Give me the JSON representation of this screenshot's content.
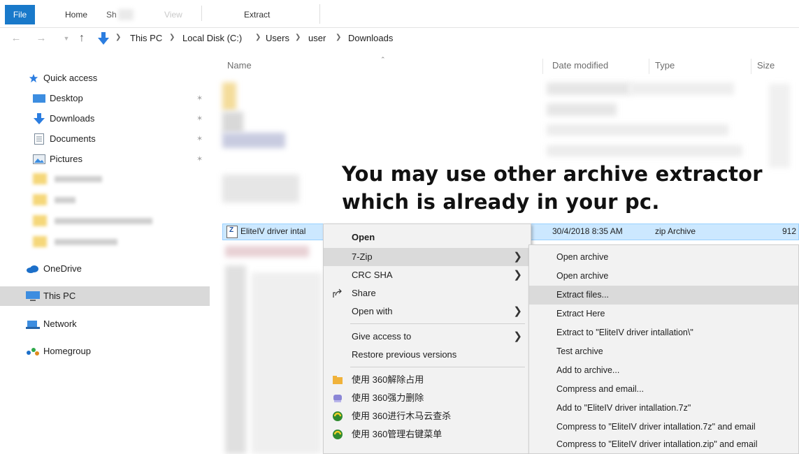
{
  "ribbon": {
    "tabs": [
      {
        "label": "File"
      },
      {
        "label": "Home"
      },
      {
        "label": "Sh"
      },
      {
        "label": "View"
      },
      {
        "label": "Extract"
      }
    ]
  },
  "address": {
    "crumbs": [
      "This PC",
      "Local Disk (C:)",
      "Users",
      "user",
      "Downloads"
    ]
  },
  "nav": {
    "quick_access": "Quick access",
    "pinned": [
      {
        "label": "Desktop",
        "icon": "desktop-icon"
      },
      {
        "label": "Downloads",
        "icon": "download-arrow-icon"
      },
      {
        "label": "Documents",
        "icon": "documents-icon"
      },
      {
        "label": "Pictures",
        "icon": "pictures-icon"
      }
    ],
    "pin_glyph": "✶",
    "onedrive": "OneDrive",
    "this_pc": "This PC",
    "network": "Network",
    "homegroup": "Homegroup"
  },
  "list": {
    "columns": {
      "name": "Name",
      "date": "Date modified",
      "type": "Type",
      "size": "Size"
    },
    "selected": {
      "name": "EliteIV driver intal",
      "date": "30/4/2018 8:35 AM",
      "type": "zip Archive",
      "size": "912"
    }
  },
  "caption": {
    "line1": "You may use other archive extractor",
    "line2": "which is already in your pc."
  },
  "context_menu": {
    "items": [
      {
        "label": "Open"
      },
      {
        "label": "7-Zip"
      },
      {
        "label": "CRC SHA"
      },
      {
        "label": "Share"
      },
      {
        "label": "Open with"
      },
      {
        "label": "Give access to"
      },
      {
        "label": "Restore previous versions"
      },
      {
        "label": "使用 360解除占用"
      },
      {
        "label": "使用 360强力删除"
      },
      {
        "label": "使用 360进行木马云查杀"
      },
      {
        "label": "使用 360管理右键菜单"
      }
    ],
    "submenu_arrow": "❯"
  },
  "submenu": {
    "items": [
      {
        "label": "Open archive"
      },
      {
        "label": "Open archive"
      },
      {
        "label": "Extract files..."
      },
      {
        "label": "Extract Here"
      },
      {
        "label": "Extract to \"EliteIV driver intallation\\\""
      },
      {
        "label": "Test archive"
      },
      {
        "label": "Add to archive..."
      },
      {
        "label": "Compress and email..."
      },
      {
        "label": "Add to \"EliteIV driver intallation.7z\""
      },
      {
        "label": "Compress to \"EliteIV driver intallation.7z\" and email"
      },
      {
        "label": "Compress to \"EliteIV driver intallation.zip\" and email"
      }
    ]
  },
  "colors": {
    "file_tab": "#1979ca",
    "selection": "#cce8ff",
    "menu_bg": "#f2f2f2",
    "menu_hover": "#dadada"
  }
}
